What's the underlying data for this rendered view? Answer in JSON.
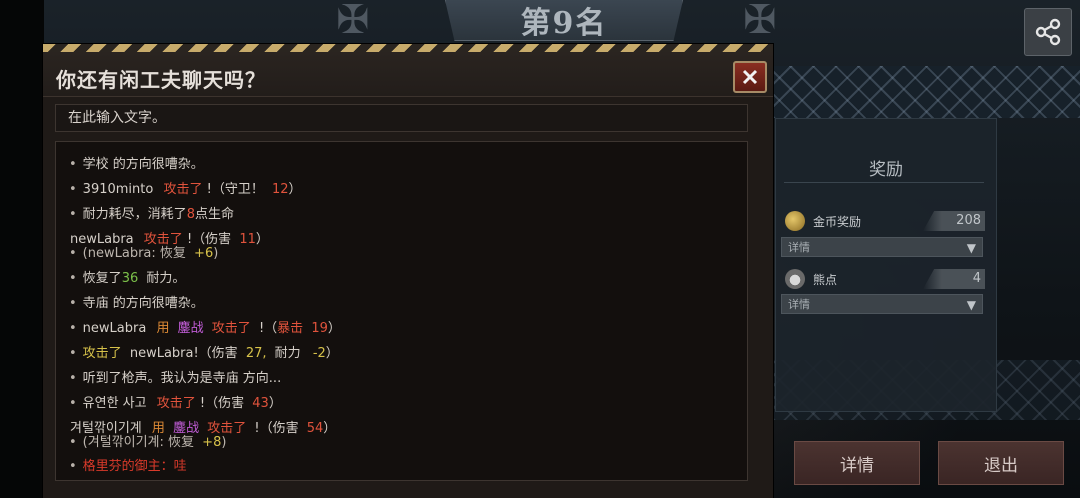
{
  "header": {
    "rank_title": "第9名"
  },
  "reward": {
    "title": "奖励",
    "gold": {
      "label": "金币奖励",
      "value": "208",
      "select": "详情"
    },
    "bear": {
      "label": "熊点",
      "value": "4",
      "select": "详情"
    }
  },
  "buttons": {
    "details": "详情",
    "exit": "退出"
  },
  "chat": {
    "title": "你还有闲工夫聊天吗？",
    "input_placeholder": "在此输入文字。",
    "log": {
      "l1": {
        "a": "学校 的方向很嘈杂。"
      },
      "l2": {
        "a": "3910minto",
        "b": "攻击了",
        "c": "!（守卫！",
        "d": "12",
        "e": "）"
      },
      "l3": {
        "a": "耐力耗尽，消耗了",
        "b": "8",
        "c": "点生命"
      },
      "l4": {
        "a": "newLabra",
        "b": "攻击了",
        "c": "!（伤害",
        "d": "11",
        "e": "）",
        "f": "(newLabra: 恢复",
        "g": "+6",
        "h": ")"
      },
      "l5": {
        "a": "恢复了",
        "b": "36",
        "c": "耐力。"
      },
      "l6": {
        "a": "寺庙 的方向很嘈杂。"
      },
      "l7": {
        "a": "newLabra",
        "b": "用",
        "c": "鏖战",
        "d": "攻击了",
        "e": "!（",
        "f": "暴击",
        "g": "19",
        "h": "）"
      },
      "l8": {
        "a": "攻击了",
        "b": "newLabra!（伤害",
        "c": "27,",
        "d": "耐力",
        "e": "-2",
        "f": "）"
      },
      "l9": {
        "a": "听到了枪声。我认为是寺庙 方向..."
      },
      "l10": {
        "a": "유연한 사고",
        "b": "攻击了",
        "c": "!（伤害",
        "d": "43",
        "e": "）"
      },
      "l11": {
        "a": "겨털깎이기계",
        "b": "用",
        "c": "鏖战",
        "d": "攻击了",
        "e": "!（伤害",
        "f": "54",
        "g": "）",
        "h": "(겨털깎이기계: 恢复",
        "i": "+8",
        "j": ")"
      },
      "l12": {
        "a": "格里芬的御主：哇"
      }
    }
  }
}
